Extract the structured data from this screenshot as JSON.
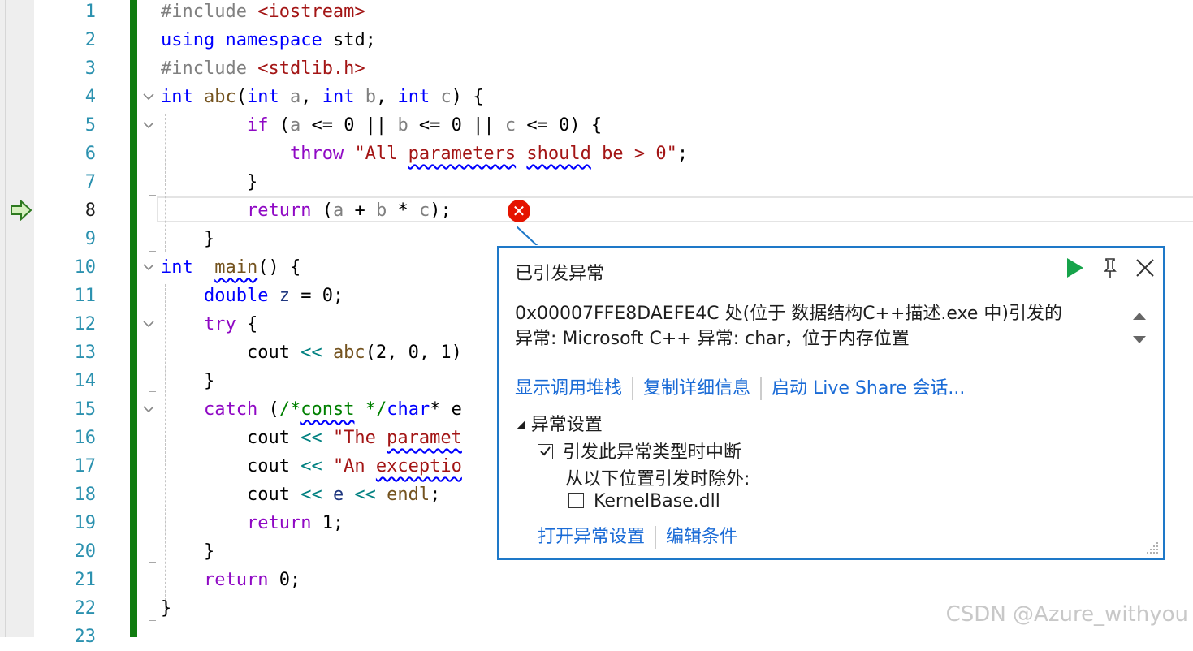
{
  "editor": {
    "line_numbers": [
      "1",
      "2",
      "3",
      "4",
      "5",
      "6",
      "7",
      "8",
      "9",
      "10",
      "11",
      "12",
      "13",
      "14",
      "15",
      "16",
      "17",
      "18",
      "19",
      "20",
      "21",
      "22",
      "23"
    ],
    "current_line": "8"
  },
  "code": {
    "l1": {
      "a": "#include ",
      "b": "<iostream>"
    },
    "l2": {
      "a": "using",
      "b": " ",
      "c": "namespace",
      "d": " std;"
    },
    "l3": {
      "a": "#include ",
      "b": "<stdlib.h>"
    },
    "l4": {
      "a": "int",
      "b": " ",
      "c": "abc",
      "d": "(",
      "e": "int",
      "f": " ",
      "g": "a",
      "h": ", ",
      "i": "int",
      "j": " ",
      "k": "b",
      "l": ", ",
      "m": "int",
      "n": " ",
      "o": "c",
      "p": ") {"
    },
    "l5": {
      "indent": "        ",
      "a": "if",
      "b": " (",
      "c": "a",
      "d": " <= 0 || ",
      "e": "b",
      "f": " <= 0 || ",
      "g": "c",
      "h": " <= 0) {"
    },
    "l6": {
      "indent": "            ",
      "a": "throw",
      "b": " ",
      "c": "\"All ",
      "d": "parameters",
      "e": " ",
      "f": "should",
      "g": " be > 0\"",
      "h": ";"
    },
    "l7": {
      "indent": "        ",
      "a": "}"
    },
    "l8": {
      "indent": "        ",
      "a": "return",
      "b": " (",
      "c": "a",
      "d": " + ",
      "e": "b",
      "f": " * ",
      "g": "c",
      "h": ");"
    },
    "l9": {
      "indent": "    ",
      "a": "}"
    },
    "l10": {
      "a": "int",
      "b": "  ",
      "c": "main",
      "d": "() {"
    },
    "l11": {
      "indent": "    ",
      "a": "double",
      "b": " ",
      "c": "z",
      "d": " = 0;"
    },
    "l12": {
      "indent": "    ",
      "a": "try",
      "b": " {"
    },
    "l13": {
      "indent": "        ",
      "a": "cout",
      "b": " << ",
      "c": "abc",
      "d": "(2, 0, 1)"
    },
    "l14": {
      "indent": "    ",
      "a": "}"
    },
    "l15": {
      "indent": "    ",
      "a": "catch",
      "b": " (",
      "c": "/*",
      "d": "const",
      "e": " */",
      "f": "char",
      "g": "* e"
    },
    "l16": {
      "indent": "        ",
      "a": "cout",
      "b": " << ",
      "c": "\"The ",
      "d": "paramet"
    },
    "l17": {
      "indent": "        ",
      "a": "cout",
      "b": " << ",
      "c": "\"An ",
      "d": "exceptio"
    },
    "l18": {
      "indent": "        ",
      "a": "cout",
      "b": " << ",
      "c": "e",
      "d": " << ",
      "e": "endl",
      "f": ";"
    },
    "l19": {
      "indent": "        ",
      "a": "return",
      "b": " 1;"
    },
    "l20": {
      "indent": "    ",
      "a": "}"
    },
    "l21": {
      "indent": "    ",
      "a": "return",
      "b": " 0;"
    },
    "l22": {
      "a": "}"
    }
  },
  "exception_popup": {
    "title": "已引发异常",
    "message_line1": "0x00007FFE8DAEFE4C 处(位于 数据结构C++描述.exe 中)引发的",
    "message_line2": "异常: Microsoft C++ 异常: char，位于内存位置",
    "links": [
      "显示调用堆栈",
      "复制详细信息",
      "启动 Live Share 会话..."
    ],
    "settings_heading": "异常设置",
    "break_checkbox_label": "引发此异常类型时中断",
    "break_checked": true,
    "except_label": "从以下位置引发时除外:",
    "module_checkbox_label": "KernelBase.dll",
    "module_checked": false,
    "bottom_links": [
      "打开异常设置",
      "编辑条件"
    ],
    "icons": {
      "continue": "play-icon",
      "pin": "pin-icon",
      "close": "close-icon"
    },
    "accent_color": "#1e78c8",
    "continue_color": "#16a34a"
  },
  "watermark": "CSDN @Azure_withyou",
  "colors": {
    "keyword": "#0000ff",
    "control": "#8f08c4",
    "string": "#a31515",
    "error": "#e51400",
    "change_bar": "#107c10"
  }
}
